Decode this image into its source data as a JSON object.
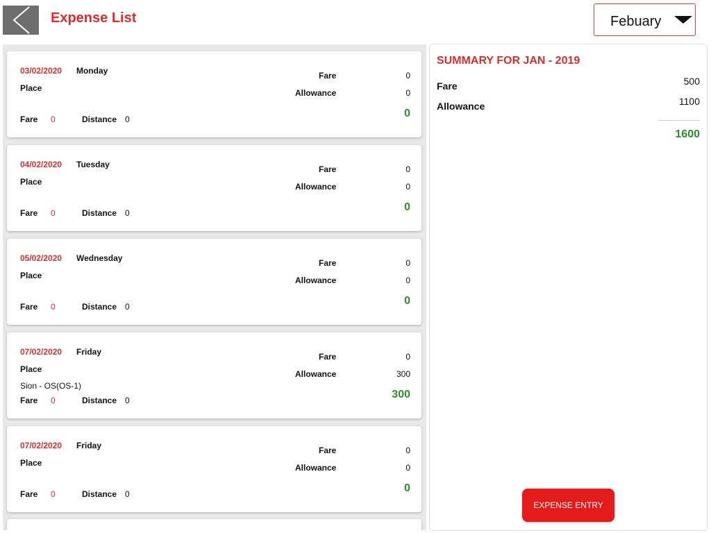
{
  "header": {
    "title": "Expense List",
    "month_selected": "Febuary"
  },
  "expenses": [
    {
      "date": "03/02/2020",
      "day": "Monday",
      "place_label": "Place",
      "place": "",
      "fare_label": "Fare",
      "fare": "0",
      "allowance_label": "Allowance",
      "allowance": "0",
      "trip_fare_label": "Fare",
      "trip_fare": "0",
      "distance_label": "Distance",
      "distance": "0",
      "total": "0"
    },
    {
      "date": "04/02/2020",
      "day": "Tuesday",
      "place_label": "Place",
      "place": "",
      "fare_label": "Fare",
      "fare": "0",
      "allowance_label": "Allowance",
      "allowance": "0",
      "trip_fare_label": "Fare",
      "trip_fare": "0",
      "distance_label": "Distance",
      "distance": "0",
      "total": "0"
    },
    {
      "date": "05/02/2020",
      "day": "Wednesday",
      "place_label": "Place",
      "place": "",
      "fare_label": "Fare",
      "fare": "0",
      "allowance_label": "Allowance",
      "allowance": "0",
      "trip_fare_label": "Fare",
      "trip_fare": "0",
      "distance_label": "Distance",
      "distance": "0",
      "total": "0"
    },
    {
      "date": "07/02/2020",
      "day": "Friday",
      "place_label": "Place",
      "place": "Sion - OS(OS-1)",
      "fare_label": "Fare",
      "fare": "0",
      "allowance_label": "Allowance",
      "allowance": "300",
      "trip_fare_label": "Fare",
      "trip_fare": "0",
      "distance_label": "Distance",
      "distance": "0",
      "total": "300"
    },
    {
      "date": "07/02/2020",
      "day": "Friday",
      "place_label": "Place",
      "place": "",
      "fare_label": "Fare",
      "fare": "0",
      "allowance_label": "Allowance",
      "allowance": "0",
      "trip_fare_label": "Fare",
      "trip_fare": "0",
      "distance_label": "Distance",
      "distance": "0",
      "total": "0"
    }
  ],
  "summary": {
    "title": "SUMMARY FOR JAN - 2019",
    "fare_label": "Fare",
    "fare": "500",
    "allowance_label": "Allowance",
    "allowance": "1100",
    "total": "1600",
    "entry_button": "EXPENSE ENTRY"
  },
  "icons": {
    "back": "chevron-left-icon",
    "dropdown": "caret-down-icon"
  },
  "colors": {
    "accent": "#e22a2a",
    "total_green": "#2e8b2e",
    "button_red": "#e31b1b",
    "back_gray": "#6e6e6e"
  }
}
